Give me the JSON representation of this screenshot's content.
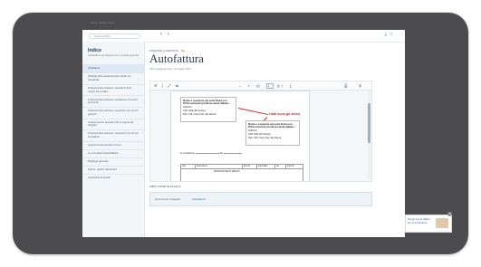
{
  "breadcrumb": "Home › Moduli › Fisco",
  "header": {
    "search_placeholder": "Cerca nel libro",
    "nav_arrows": "‹  ›",
    "icons": [
      "download-icon",
      "star-icon"
    ]
  },
  "sidebar": {
    "title": "Indice",
    "subtitle": "Autofattura nel sistema Iva e modelli operativi",
    "items": [
      {
        "label": "Autofattura",
        "active": true
      },
      {
        "label": "Obblighi dello splafonamento ridotto nel trimestrale",
        "active": false
      },
      {
        "label": "Professionista straniero: operazioni fuori campo Iva in Italia",
        "active": false
      },
      {
        "label": "Professionista straniero: prestazione di servizi generiche",
        "active": false
      },
      {
        "label": "Professionista straniero: operazioni con servizi generici",
        "active": false
      },
      {
        "label": "Acquisti presso operatori UE in regime del margine",
        "active": false
      },
      {
        "label": "Professionista straniero: operazioni con servizi immobiliari",
        "active": false
      },
      {
        "label": "Acquisti intracomunitari di beni",
        "active": false
      },
      {
        "label": "La normativa sull'autofattura",
        "active": false
      },
      {
        "label": "Riepilogo generale",
        "active": false
      },
      {
        "label": "Fatture: quadro riassuntivo",
        "active": false
      },
      {
        "label": "Operazioni territoriali",
        "active": false
      }
    ]
  },
  "main": {
    "kicker": "DOMANDE & RISPOSTE",
    "kicker_tag": "Iva",
    "title": "Autofattura",
    "meta": "Ultimo aggiornamento: 14 maggio 2024",
    "toolbar": {
      "left": "☰ | ⤢  ⇆",
      "middle": "− + ⊟",
      "page": "1",
      "page_total": "di 1",
      "right": "⎙ ⇩"
    },
    "document": {
      "box1_title": "Nome e cognome persona fisica con",
      "box1_line2": "P.IVA estera del professionista italiano",
      "box1_line3": "Indirizzo",
      "box1_line4": "CAP Città (Provincia)",
      "box1_line5": "Part. IVA / Cod. Fisc. del cliente",
      "note": "I dati sono gli stessi",
      "box2_line1": "Nome e cognome persona fisica con",
      "box2_line2": "P.IVA estera del professionista italiano",
      "box2_line3": "Indirizzo",
      "box2_line4": "CAP Città (Provincia)",
      "box2_line5": "Part. IVA / Cod. Fisc. del cliente",
      "row_label": "N. Autofattura",
      "row_label2": "del",
      "table_headers": [
        "Qtà",
        "Descrizione",
        "Prezzo",
        "Imponibile",
        "Iva",
        "Importo"
      ],
      "table_cell": "PRESTAZIONE DI SERVIZI"
    },
    "isbn": "ISBN: 978-88-6279-022-5",
    "related_label": "Documento collegato",
    "related_link": "Autofattura"
  },
  "ad": {
    "text": "Scopri con le offerte per te su Amazon"
  },
  "colors": {
    "frame": "#4c4c4f",
    "accent": "#2d6cb5",
    "note_red": "#d8262c",
    "tag_orange": "#d2691e"
  }
}
